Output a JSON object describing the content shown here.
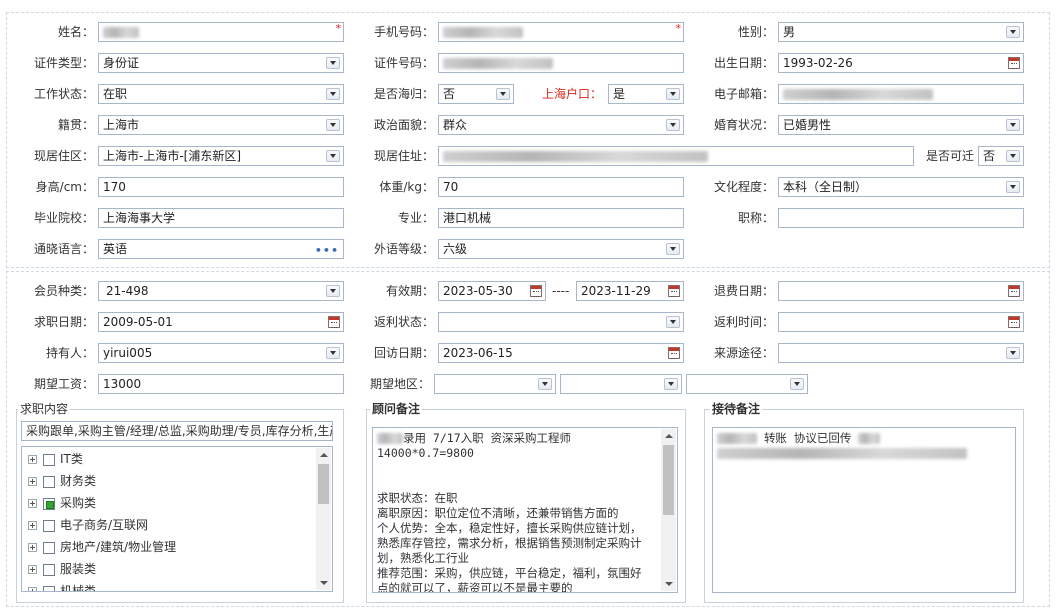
{
  "form": {
    "row1": {
      "name_label": "姓名：",
      "name_value": "",
      "phone_label": "手机号码：",
      "phone_value": "",
      "gender_label": "性别：",
      "gender_value": "男",
      "required_mark": "*"
    },
    "row2": {
      "idtype_label": "证件类型：",
      "idtype_value": "身份证",
      "idno_label": "证件号码：",
      "idno_value": "",
      "birth_label": "出生日期：",
      "birth_value": "1993-02-26"
    },
    "row3": {
      "work_label": "工作状态：",
      "work_value": "在职",
      "returnee_label": "是否海归：",
      "returnee_value": "否",
      "hukou_label": "上海户口：",
      "hukou_value": "是",
      "email_label": "电子邮箱：",
      "email_value": ""
    },
    "row4": {
      "native_label": "籍贯：",
      "native_value": "上海市",
      "political_label": "政治面貌：",
      "political_value": "群众",
      "marital_label": "婚育状况：",
      "marital_value": "已婚男性"
    },
    "row5": {
      "area_label": "现居住区：",
      "area_value": "上海市-上海市-[浦东新区]",
      "address_label": "现居住址：",
      "address_value": "",
      "relocate_label": "是否可迁",
      "relocate_value": "否"
    },
    "row6": {
      "height_label": "身高/cm：",
      "height_value": "170",
      "weight_label": "体重/kg：",
      "weight_value": "70",
      "edu_label": "文化程度：",
      "edu_value": "本科（全日制）"
    },
    "row7": {
      "school_label": "毕业院校：",
      "school_value": "上海海事大学",
      "major_label": "专业：",
      "major_value": "港口机械",
      "title_label": "职称：",
      "title_value": ""
    },
    "row8": {
      "lang_label": "通晓语言：",
      "lang_value": "英语",
      "lang_more": "•••",
      "foreign_label": "外语等级：",
      "foreign_value": "六级"
    }
  },
  "membership": {
    "type_label": "会员种类：",
    "type_value": "21-498",
    "valid_label": "有效期：",
    "valid_from": "2023-05-30",
    "valid_sep": "----",
    "valid_to": "2023-11-29",
    "refund_label": "退费日期：",
    "refund_value": "",
    "jobdate_label": "求职日期：",
    "jobdate_value": "2009-05-01",
    "rebate_status_label": "返利状态：",
    "rebate_status_value": "",
    "rebate_time_label": "返利时间：",
    "rebate_time_value": "",
    "holder_label": "持有人：",
    "holder_value": "yirui005",
    "visit_label": "回访日期：",
    "visit_value": "2023-06-15",
    "source_label": "来源途径：",
    "source_value": "",
    "salary_label": "期望工资：",
    "salary_value": "13000",
    "region_label": "期望地区："
  },
  "job": {
    "title": "求职内容",
    "summary": "采购跟单,采购主管/经理/总监,采购助理/专员,库存分析,生产",
    "categories": [
      {
        "label": "IT类"
      },
      {
        "label": "财务类"
      },
      {
        "label": "采购类"
      },
      {
        "label": "电子商务/互联网"
      },
      {
        "label": "房地产/建筑/物业管理"
      },
      {
        "label": "服装类"
      },
      {
        "label": "机械类"
      }
    ]
  },
  "advisor": {
    "title": "顾问备注",
    "lines": [
      "录用  7/17入职  资深采购工程师",
      "14000*0.7=9800",
      "",
      "",
      "求职状态：在职",
      "离职原因：职位定位不清晰，还兼带销售方面的",
      "个人优势：全本，稳定性好，擅长采购供应链计划，",
      "熟悉库存管控，需求分析，根据销售预测制定采购计",
      "划，熟悉化工行业",
      "推荐范围：采购，供应链，平台稳定，福利，氛围好",
      "点的就可以了，薪资可以不是最主要的"
    ]
  },
  "reception": {
    "title": "接待备注",
    "line1": "转账 协议已回传"
  }
}
